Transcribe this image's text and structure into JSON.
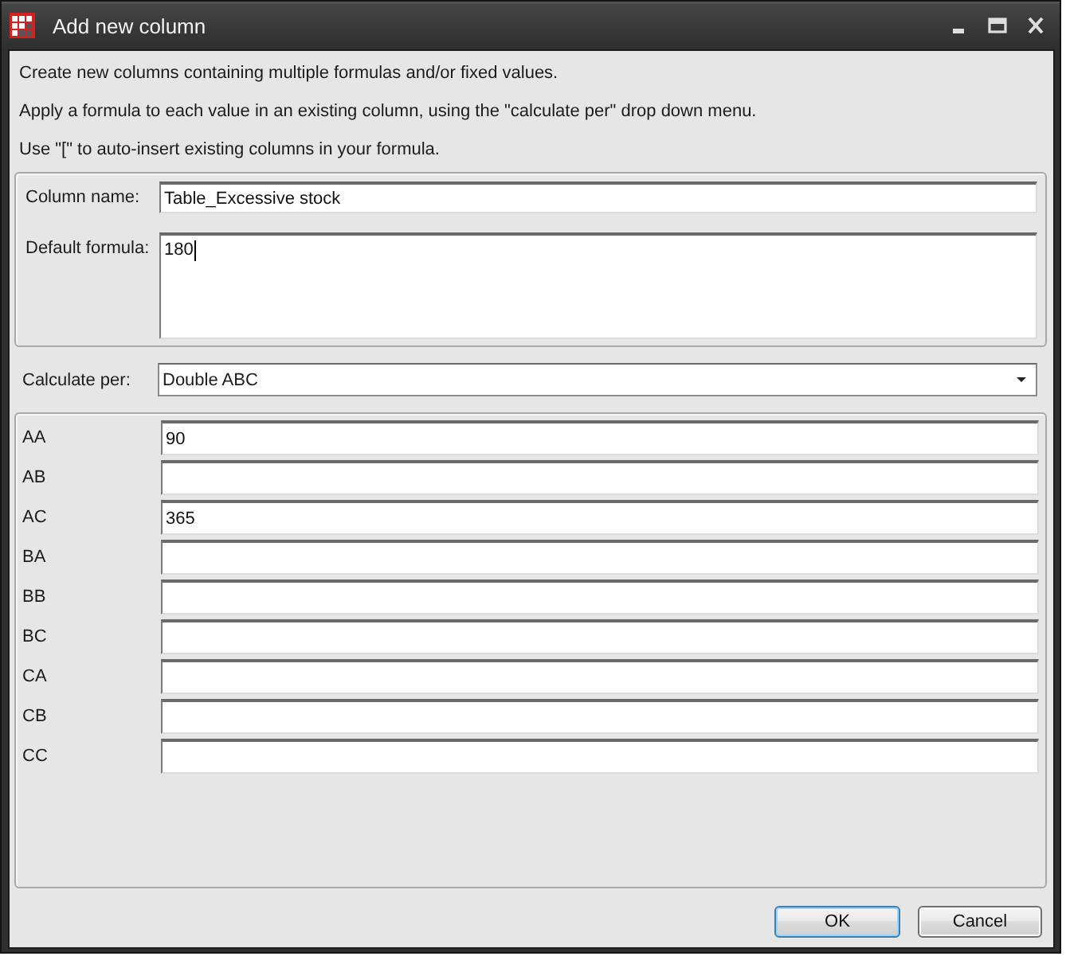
{
  "window": {
    "title": "Add new column"
  },
  "intro": [
    "Create new columns containing multiple formulas and/or fixed values.",
    "Apply a formula to each value in an existing column, using the \"calculate per\" drop down menu.",
    "Use \"[\" to auto-insert existing columns in your formula."
  ],
  "column_name": {
    "label": "Column name:",
    "value": "Table_Excessive stock"
  },
  "default_formula": {
    "label": "Default formula:",
    "value": "180",
    "focused": true
  },
  "calculate_per": {
    "label": "Calculate per:",
    "value": "Double ABC"
  },
  "per_values": [
    {
      "label": "AA",
      "value": "90"
    },
    {
      "label": "AB"
    },
    {
      "label": "AC",
      "value": "365"
    },
    {
      "label": "BA"
    },
    {
      "label": "BB"
    },
    {
      "label": "BC"
    },
    {
      "label": "CA"
    },
    {
      "label": "CB"
    },
    {
      "label": "CC"
    }
  ],
  "buttons": [
    {
      "label": "OK",
      "default": true
    },
    {
      "label": "Cancel",
      "default": false
    }
  ]
}
